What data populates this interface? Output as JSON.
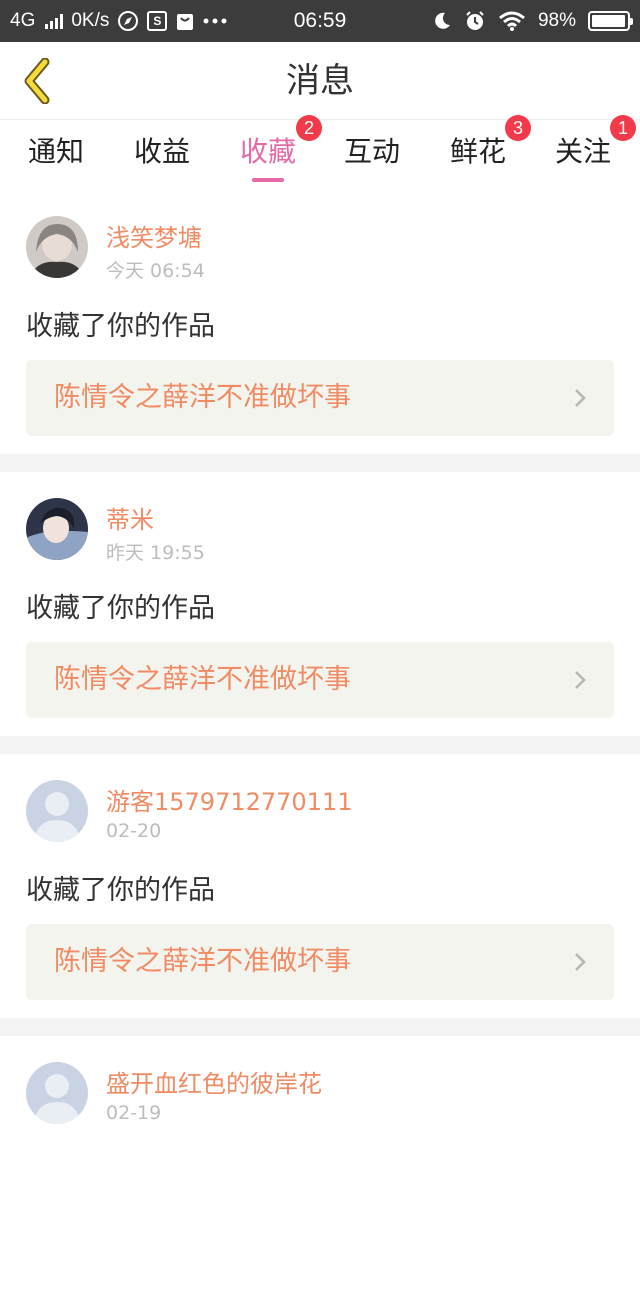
{
  "status_bar": {
    "network": "4G",
    "speed": "0K/s",
    "time": "06:59",
    "battery": "98%",
    "battery_level": 0.98
  },
  "header": {
    "title": "消息",
    "back_icon": "chevron-left-icon"
  },
  "tabs": [
    {
      "label": "通知",
      "badge": ""
    },
    {
      "label": "收益",
      "badge": ""
    },
    {
      "label": "收藏",
      "badge": "2",
      "active": true
    },
    {
      "label": "互动",
      "badge": ""
    },
    {
      "label": "鲜花",
      "badge": "3"
    },
    {
      "label": "关注",
      "badge": "1"
    }
  ],
  "colors": {
    "accent": "#e76aa6",
    "name": "#f08b63",
    "badge": "#f23a4a"
  },
  "feed": [
    {
      "user": "浅笑梦塘",
      "time": "今天 06:54",
      "action": "收藏了你的作品",
      "work": "陈情令之薛洋不准做坏事"
    },
    {
      "user": "蒂米",
      "time": "昨天 19:55",
      "action": "收藏了你的作品",
      "work": "陈情令之薛洋不准做坏事"
    },
    {
      "user": "游客1579712770111",
      "time": "02-20",
      "action": "收藏了你的作品",
      "work": "陈情令之薛洋不准做坏事"
    },
    {
      "user": "盛开血红色的彼岸花",
      "time": "02-19",
      "action": "",
      "work": ""
    }
  ]
}
